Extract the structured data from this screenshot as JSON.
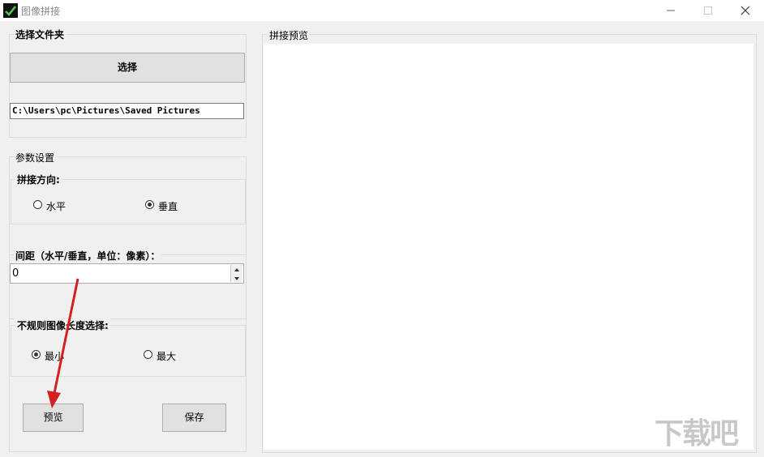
{
  "window": {
    "title": "图像拼接",
    "minimize_icon": "minimize-icon",
    "maximize_icon": "maximize-icon",
    "close_icon": "close-icon"
  },
  "folder_section": {
    "legend": "选择文件夹",
    "select_button": "选择",
    "path_value": "C:\\Users\\pc\\Pictures\\Saved Pictures"
  },
  "params": {
    "legend": "参数设置",
    "direction": {
      "label": "拼接方向:",
      "options": [
        "水平",
        "垂直"
      ],
      "selected": "垂直"
    },
    "spacing": {
      "label": "间距（水平/垂直，单位：像素）：",
      "value": "0"
    },
    "irregular": {
      "label": "不规则图像长度选择:",
      "options": [
        "最小",
        "最大"
      ],
      "selected": "最小"
    }
  },
  "actions": {
    "preview_button": "预览",
    "save_button": "保存"
  },
  "preview_panel": {
    "legend": "拼接预览"
  },
  "watermark": "下载吧",
  "colors": {
    "arrow": "#d42020",
    "window_bg": "#f0f0f0"
  }
}
